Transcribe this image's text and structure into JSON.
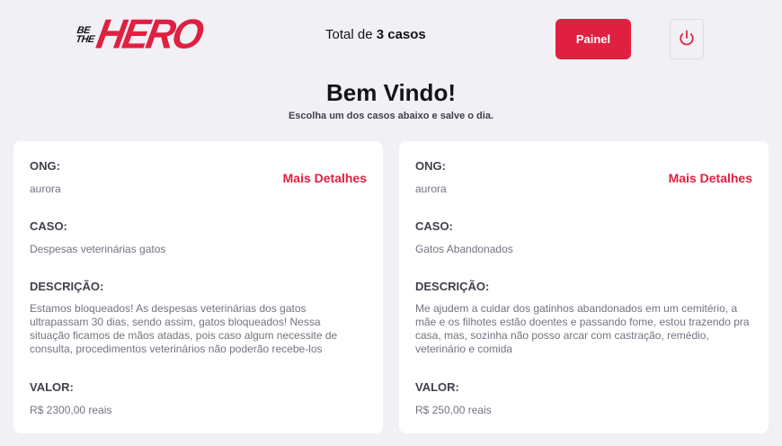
{
  "header": {
    "logo_small_1": "BE",
    "logo_small_2": "THE",
    "logo_big": "HERO",
    "total_prefix": "Total de",
    "total_count": "3 casos",
    "painel_label": "Painel",
    "logout_icon": "power-icon"
  },
  "welcome": {
    "title": "Bem Vindo!",
    "subtitle": "Escolha um dos casos abaixo e salve o dia."
  },
  "labels": {
    "ong": "ONG:",
    "caso": "CASO:",
    "descricao": "DESCRIÇÃO:",
    "valor": "VALOR:",
    "more": "Mais Detalhes"
  },
  "cases": [
    {
      "ong": "aurora",
      "caso": "Despesas veterinárias gatos",
      "descricao": "Estamos bloqueados! As despesas veterinárias dos gatos ultrapassam 30 dias, sendo assim, gatos bloqueados! Nessa situação ficamos de mãos atadas, pois caso algum necessite de consulta, procedimentos veterinários não poderão recebe-los",
      "valor": "R$ 2300,00 reais"
    },
    {
      "ong": "aurora",
      "caso": "Gatos Abandonados",
      "descricao": "Me ajudem a cuidar dos gatinhos abandonados em um cemitério, a mãe e os filhotes estão doentes e passando fome, estou trazendo pra casa, mas, sozinha não posso arcar com castração, remédio, veterinário e comida",
      "valor": "R$ 250,00 reais"
    }
  ],
  "colors": {
    "accent": "#e02041",
    "background": "#f0f0f5",
    "card": "#ffffff"
  }
}
